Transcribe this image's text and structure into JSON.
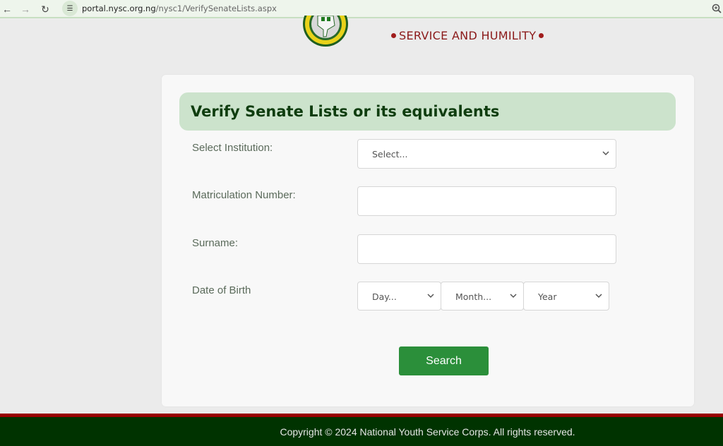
{
  "browser": {
    "back_icon": "arrow-left-icon",
    "forward_icon": "arrow-right-icon",
    "reload_icon": "reload-icon",
    "site_info_icon": "tune-icon",
    "url_host": "portal.nysc.org.ng",
    "url_path": "/nysc1/VerifySenateLists.aspx",
    "zoom_icon": "zoom-in-icon"
  },
  "header": {
    "logo": "nysc-logo",
    "motto": "SERVICE AND HUMILITY"
  },
  "form": {
    "title": "Verify Senate Lists or its equivalents",
    "institution": {
      "label": "Select Institution:",
      "selected": "Select..."
    },
    "matric": {
      "label": "Matriculation Number:",
      "value": ""
    },
    "surname": {
      "label": "Surname:",
      "value": ""
    },
    "dob": {
      "label": "Date of Birth",
      "day": "Day...",
      "month": "Month...",
      "year": "Year"
    },
    "search_label": "Search"
  },
  "footer": {
    "copyright": "Copyright © 2024 National Youth Service Corps. All rights reserved."
  },
  "colors": {
    "header_bg": "#cce3cc",
    "title": "#0f3d0f",
    "button": "#2b8f3a",
    "footer_bg": "#003300",
    "footer_stripe": "#990000",
    "motto": "#8b1a1a"
  }
}
